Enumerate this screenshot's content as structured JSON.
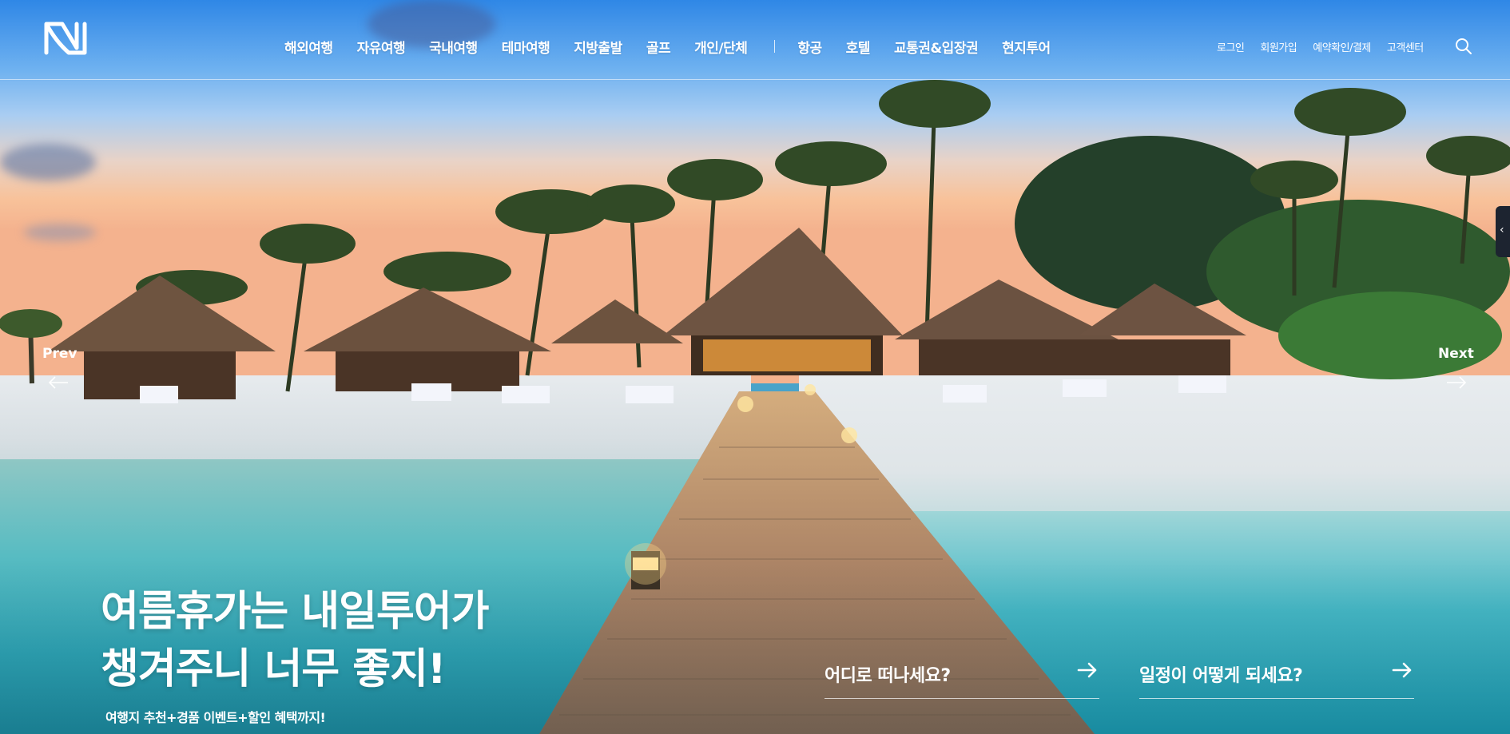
{
  "header": {
    "logo": {
      "name": "N-logo",
      "alt": ""
    },
    "nav": {
      "items": [
        {
          "label": "해외여행"
        },
        {
          "label": "자유여행"
        },
        {
          "label": "국내여행"
        },
        {
          "label": "테마여행"
        },
        {
          "label": "지방출발"
        },
        {
          "label": "골프"
        },
        {
          "label": "개인/단체"
        }
      ],
      "items2": [
        {
          "label": "항공"
        },
        {
          "label": "호텔"
        },
        {
          "label": "교통권&입장권"
        },
        {
          "label": "현지투어"
        }
      ]
    },
    "util": [
      {
        "label": "로그인"
      },
      {
        "label": "회원가입"
      },
      {
        "label": "예약확인/결제"
      },
      {
        "label": "고객센터"
      }
    ],
    "search_icon": "search-icon"
  },
  "slider": {
    "prev_label": "Prev",
    "next_label": "Next",
    "side_tab_glyph": "‹"
  },
  "hero": {
    "headline_line1": "여름휴가는 내일투어가",
    "headline_line2": "챙겨주니 너무 좋지!",
    "subline": "여행지 추천+경품 이벤트+할인 혜택까지!"
  },
  "quick_search": {
    "where": {
      "label": "어디로 떠나세요?"
    },
    "when": {
      "label": "일정이 어떻게 되세요?"
    }
  },
  "colors": {
    "header_text": "#ffffff",
    "sky_top": "#2f87e6",
    "water": "#2fa5b6"
  }
}
